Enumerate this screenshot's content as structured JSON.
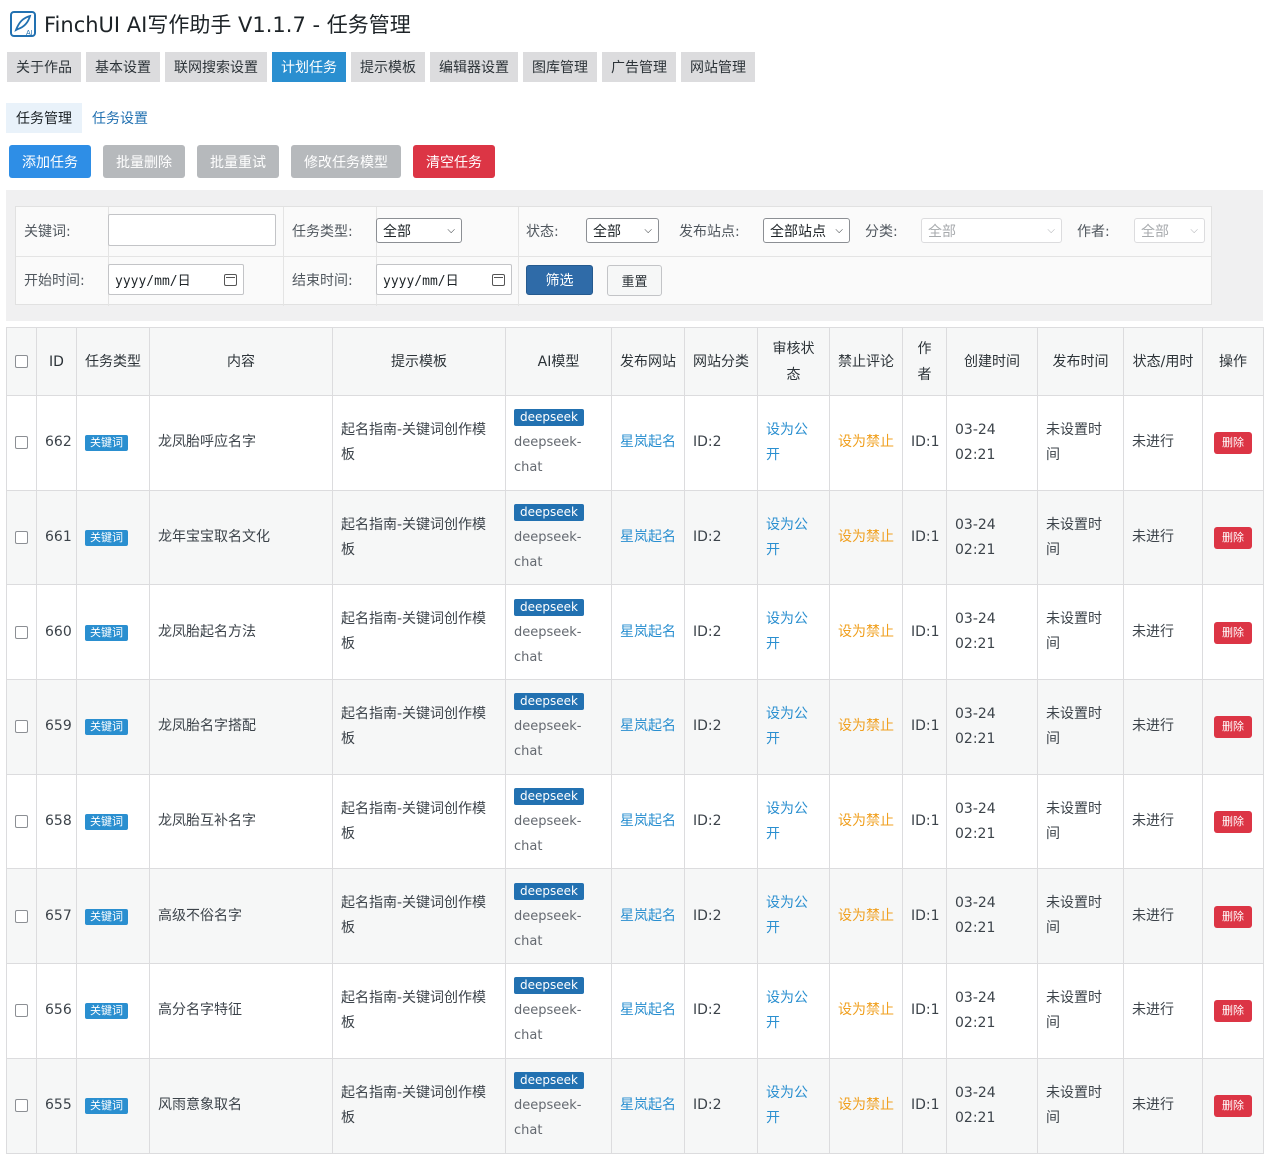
{
  "app": {
    "title": "FinchUI AI写作助手 V1.1.7 - 任务管理",
    "logo_text": "AI"
  },
  "main_tabs": [
    {
      "label": "关于作品"
    },
    {
      "label": "基本设置"
    },
    {
      "label": "联网搜索设置"
    },
    {
      "label": "计划任务",
      "active": true
    },
    {
      "label": "提示模板"
    },
    {
      "label": "编辑器设置"
    },
    {
      "label": "图库管理"
    },
    {
      "label": "广告管理"
    },
    {
      "label": "网站管理"
    }
  ],
  "sub_tabs": [
    {
      "label": "任务管理",
      "active": true
    },
    {
      "label": "任务设置"
    }
  ],
  "actions": {
    "add": "添加任务",
    "batch_delete": "批量删除",
    "batch_retry": "批量重试",
    "edit_model": "修改任务模型",
    "clear": "清空任务"
  },
  "filters": {
    "keyword_label": "关键词:",
    "keyword_value": "",
    "type_label": "任务类型:",
    "type_value": "全部",
    "status_label": "状态:",
    "status_value": "全部",
    "site_label": "发布站点:",
    "site_value": "全部站点",
    "category_label": "分类:",
    "category_value": "全部",
    "author_label": "作者:",
    "author_value": "全部",
    "start_label": "开始时间:",
    "start_value": "yyyy/mm/日",
    "end_label": "结束时间:",
    "end_value": "yyyy/mm/日",
    "filter_btn": "筛选",
    "reset_btn": "重置"
  },
  "table": {
    "headers": {
      "id": "ID",
      "type": "任务类型",
      "content": "内容",
      "template": "提示模板",
      "model": "AI模型",
      "site": "发布网站",
      "category": "网站分类",
      "review": "审核状态",
      "comment": "禁止评论",
      "author": "作者",
      "created": "创建时间",
      "published": "发布时间",
      "status": "状态/用时",
      "ops": "操作"
    },
    "rows": [
      {
        "id": "662",
        "type": "关键词",
        "content": "龙凤胎呼应名字",
        "template": "起名指南-关键词创作模板",
        "model_badge": "deepseek",
        "model": "deepseek-chat",
        "site": "星岚起名",
        "category": "ID:2",
        "review": "设为公开",
        "comment": "设为禁止",
        "author": "ID:1",
        "created": "03-24 02:21",
        "published": "未设置时间",
        "status": "未进行",
        "op": "删除"
      },
      {
        "id": "661",
        "type": "关键词",
        "content": "龙年宝宝取名文化",
        "template": "起名指南-关键词创作模板",
        "model_badge": "deepseek",
        "model": "deepseek-chat",
        "site": "星岚起名",
        "category": "ID:2",
        "review": "设为公开",
        "comment": "设为禁止",
        "author": "ID:1",
        "created": "03-24 02:21",
        "published": "未设置时间",
        "status": "未进行",
        "op": "删除"
      },
      {
        "id": "660",
        "type": "关键词",
        "content": "龙凤胎起名方法",
        "template": "起名指南-关键词创作模板",
        "model_badge": "deepseek",
        "model": "deepseek-chat",
        "site": "星岚起名",
        "category": "ID:2",
        "review": "设为公开",
        "comment": "设为禁止",
        "author": "ID:1",
        "created": "03-24 02:21",
        "published": "未设置时间",
        "status": "未进行",
        "op": "删除"
      },
      {
        "id": "659",
        "type": "关键词",
        "content": "龙凤胎名字搭配",
        "template": "起名指南-关键词创作模板",
        "model_badge": "deepseek",
        "model": "deepseek-chat",
        "site": "星岚起名",
        "category": "ID:2",
        "review": "设为公开",
        "comment": "设为禁止",
        "author": "ID:1",
        "created": "03-24 02:21",
        "published": "未设置时间",
        "status": "未进行",
        "op": "删除"
      },
      {
        "id": "658",
        "type": "关键词",
        "content": "龙凤胎互补名字",
        "template": "起名指南-关键词创作模板",
        "model_badge": "deepseek",
        "model": "deepseek-chat",
        "site": "星岚起名",
        "category": "ID:2",
        "review": "设为公开",
        "comment": "设为禁止",
        "author": "ID:1",
        "created": "03-24 02:21",
        "published": "未设置时间",
        "status": "未进行",
        "op": "删除"
      },
      {
        "id": "657",
        "type": "关键词",
        "content": "高级不俗名字",
        "template": "起名指南-关键词创作模板",
        "model_badge": "deepseek",
        "model": "deepseek-chat",
        "site": "星岚起名",
        "category": "ID:2",
        "review": "设为公开",
        "comment": "设为禁止",
        "author": "ID:1",
        "created": "03-24 02:21",
        "published": "未设置时间",
        "status": "未进行",
        "op": "删除"
      },
      {
        "id": "656",
        "type": "关键词",
        "content": "高分名字特征",
        "template": "起名指南-关键词创作模板",
        "model_badge": "deepseek",
        "model": "deepseek-chat",
        "site": "星岚起名",
        "category": "ID:2",
        "review": "设为公开",
        "comment": "设为禁止",
        "author": "ID:1",
        "created": "03-24 02:21",
        "published": "未设置时间",
        "status": "未进行",
        "op": "删除"
      },
      {
        "id": "655",
        "type": "关键词",
        "content": "风雨意象取名",
        "template": "起名指南-关键词创作模板",
        "model_badge": "deepseek",
        "model": "deepseek-chat",
        "site": "星岚起名",
        "category": "ID:2",
        "review": "设为公开",
        "comment": "设为禁止",
        "author": "ID:1",
        "created": "03-24 02:21",
        "published": "未设置时间",
        "status": "未进行",
        "op": "删除"
      }
    ]
  }
}
